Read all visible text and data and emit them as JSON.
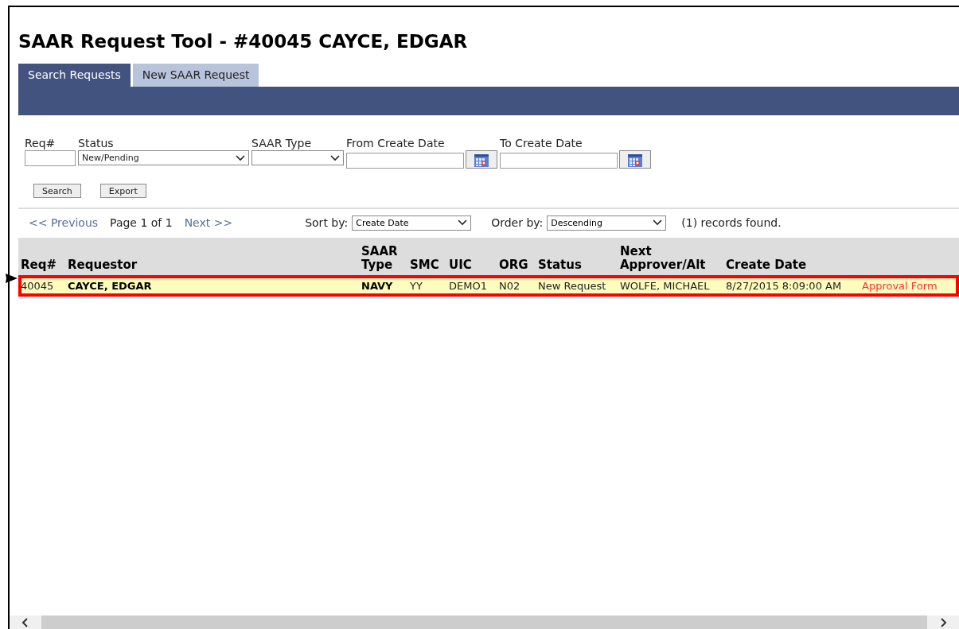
{
  "page": {
    "title": "SAAR Request Tool - #40045 CAYCE, EDGAR"
  },
  "tabs": [
    {
      "label": "Search Requests",
      "selected": true
    },
    {
      "label": "New SAAR Request",
      "selected": false
    }
  ],
  "filters": [
    {
      "kind": "text",
      "label": "Req#"
    },
    {
      "kind": "select",
      "label": "Status",
      "value": "New/Pending"
    },
    {
      "kind": "select",
      "label": "SAAR Type"
    },
    {
      "kind": "date",
      "label": "From Create Date"
    },
    {
      "kind": "date",
      "label": "To Create Date"
    }
  ],
  "buttons": [
    "Search",
    "Export"
  ],
  "pager": {
    "previous": "<< Previous",
    "page": "Page 1 of 1",
    "next": "Next >>"
  },
  "sort": {
    "label": "Sort by:",
    "value": "Create Date"
  },
  "order": {
    "label": "Order by:",
    "value": "Descending"
  },
  "records": "(1) records found.",
  "table": {
    "columns": [
      "Req#",
      "Requestor",
      "SAAR Type",
      "SMC",
      "UIC",
      "ORG",
      "Status",
      "Next Approver/Alt",
      "Create Date"
    ],
    "rows": [
      {
        "highlighted": true,
        "cells": [
          {
            "text": "40045",
            "bold": false
          },
          {
            "text": "CAYCE, EDGAR",
            "bold": true
          },
          {
            "text": "NAVY",
            "bold": true
          },
          {
            "text": "YY",
            "bold": false
          },
          {
            "text": "DEMO1",
            "bold": false
          },
          {
            "text": "N02",
            "bold": false
          },
          {
            "text": "New Request",
            "bold": false
          },
          {
            "text": "WOLFE, MICHAEL",
            "bold": false
          },
          {
            "text": "8/27/2015 8:09:00 AM",
            "bold": false
          }
        ],
        "link": "Approval Form"
      }
    ]
  }
}
